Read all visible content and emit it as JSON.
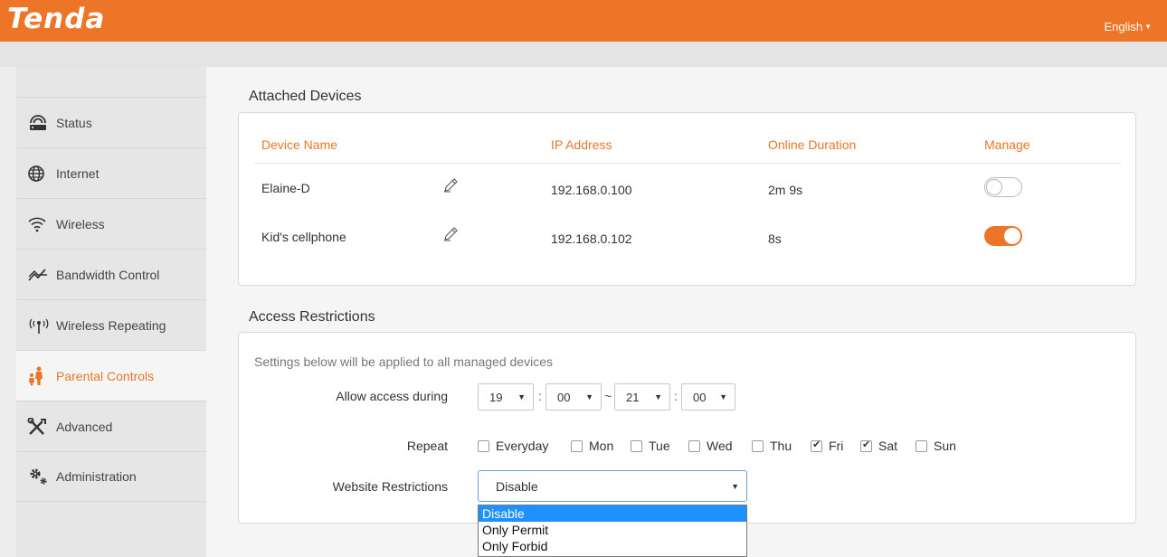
{
  "header": {
    "logo": "Tenda",
    "language": "English",
    "colors": {
      "brand": "#ec7527",
      "selected_option": "#1e90ff"
    }
  },
  "sidebar": {
    "items": [
      {
        "label": "Status",
        "icon": "router-icon",
        "active": false
      },
      {
        "label": "Internet",
        "icon": "globe-icon",
        "active": false
      },
      {
        "label": "Wireless",
        "icon": "wifi-icon",
        "active": false
      },
      {
        "label": "Bandwidth Control",
        "icon": "bandwidth-icon",
        "active": false
      },
      {
        "label": "Wireless Repeating",
        "icon": "antenna-icon",
        "active": false
      },
      {
        "label": "Parental Controls",
        "icon": "family-icon",
        "active": true
      },
      {
        "label": "Advanced",
        "icon": "tools-icon",
        "active": false
      },
      {
        "label": "Administration",
        "icon": "gears-icon",
        "active": false
      }
    ]
  },
  "attached": {
    "title": "Attached Devices",
    "columns": [
      "Device Name",
      "IP Address",
      "Online Duration",
      "Manage"
    ],
    "rows": [
      {
        "name": "Elaine-D",
        "ip": "192.168.0.100",
        "duration": "2m 9s",
        "managed": false
      },
      {
        "name": "Kid's cellphone",
        "ip": "192.168.0.102",
        "duration": "8s",
        "managed": true
      }
    ]
  },
  "access": {
    "title": "Access Restrictions",
    "note": "Settings below will be applied to all managed devices",
    "allow_label": "Allow access during",
    "start_hour": "19",
    "start_min": "00",
    "separator": "~",
    "end_hour": "21",
    "end_min": "00",
    "repeat_label": "Repeat",
    "days": [
      {
        "label": "Everyday",
        "checked": false
      },
      {
        "label": "Mon",
        "checked": false
      },
      {
        "label": "Tue",
        "checked": false
      },
      {
        "label": "Wed",
        "checked": false
      },
      {
        "label": "Thu",
        "checked": false
      },
      {
        "label": "Fri",
        "checked": true
      },
      {
        "label": "Sat",
        "checked": true
      },
      {
        "label": "Sun",
        "checked": false
      }
    ],
    "website_label": "Website Restrictions",
    "website_value": "Disable",
    "website_options": [
      "Disable",
      "Only Permit",
      "Only Forbid"
    ]
  }
}
